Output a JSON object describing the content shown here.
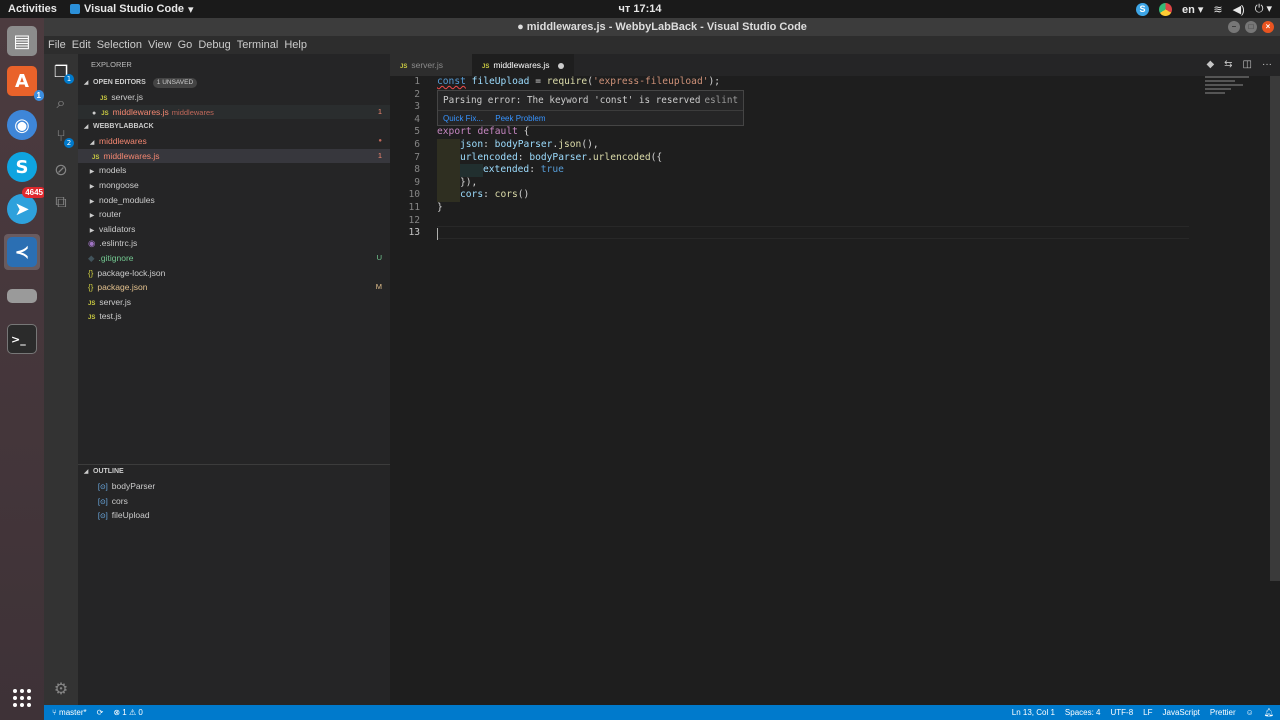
{
  "system": {
    "activities": "Activities",
    "app_name": "Visual Studio Code",
    "clock": "чт 17:14",
    "language": "en",
    "telegram_badge": "4645",
    "files_badge": "1",
    "scm_badge": "2"
  },
  "window": {
    "title": "● middlewares.js - WebbyLabBack - Visual Studio Code"
  },
  "menu": [
    "File",
    "Edit",
    "Selection",
    "View",
    "Go",
    "Debug",
    "Terminal",
    "Help"
  ],
  "explorer": {
    "title": "EXPLORER",
    "open_editors_label": "OPEN EDITORS",
    "unsaved_label": "1 UNSAVED",
    "open_editors": [
      {
        "name": "server.js",
        "folder": "",
        "badge": ""
      },
      {
        "name": "middlewares.js",
        "folder": "middlewares",
        "badge": "1"
      }
    ],
    "project_label": "WEBBYLABBACK",
    "tree": [
      {
        "name": "middlewares",
        "type": "folder-open",
        "badge": "●"
      },
      {
        "name": "middlewares.js",
        "type": "js",
        "badge": "1"
      },
      {
        "name": "models",
        "type": "folder",
        "badge": ""
      },
      {
        "name": "mongoose",
        "type": "folder",
        "badge": ""
      },
      {
        "name": "node_modules",
        "type": "folder",
        "badge": ""
      },
      {
        "name": "router",
        "type": "folder",
        "badge": ""
      },
      {
        "name": "validators",
        "type": "folder",
        "badge": ""
      },
      {
        "name": ".eslintrc.js",
        "type": "eslint",
        "badge": ""
      },
      {
        "name": ".gitignore",
        "type": "git",
        "badge": "U"
      },
      {
        "name": "package-lock.json",
        "type": "json",
        "badge": ""
      },
      {
        "name": "package.json",
        "type": "json",
        "badge": "M"
      },
      {
        "name": "server.js",
        "type": "js",
        "badge": ""
      },
      {
        "name": "test.js",
        "type": "js",
        "badge": ""
      }
    ],
    "outline_label": "OUTLINE",
    "outline": [
      "bodyParser",
      "cors",
      "fileUpload"
    ]
  },
  "tabs": [
    {
      "name": "server.js",
      "active": false
    },
    {
      "name": "middlewares.js",
      "active": true
    }
  ],
  "code": {
    "line_numbers": [
      "1",
      "2",
      "3",
      "4",
      "5",
      "6",
      "7",
      "8",
      "9",
      "10",
      "11",
      "12",
      "13"
    ],
    "lines": {
      "l1_kw": "const",
      "l1_var": "fileUpload",
      "l1_eq": " = ",
      "l1_fn": "require",
      "l1_p1": "(",
      "l1_str": "'express-fileupload'",
      "l1_p2": ");",
      "l5_kw1": "export",
      "l5_kw2": "default",
      "l5_rest": " {",
      "l6_prop": "json",
      "l6_c": ": ",
      "l6_var": "bodyParser",
      "l6_dot": ".",
      "l6_fn": "json",
      "l6_end": "(),",
      "l7_prop": "urlencoded",
      "l7_c": ": ",
      "l7_var": "bodyParser",
      "l7_dot": ".",
      "l7_fn": "urlencoded",
      "l7_end": "({",
      "l8_prop": "extended",
      "l8_c": ": ",
      "l8_kw": "true",
      "l9": "}),",
      "l10_prop": "cors",
      "l10_c": ": ",
      "l10_fn": "cors",
      "l10_end": "()",
      "l11": "}"
    }
  },
  "hover": {
    "message": "Parsing error: The keyword 'const' is reserved",
    "source": "eslint",
    "quick_fix": "Quick Fix...",
    "peek_problem": "Peek Problem"
  },
  "status": {
    "branch": "master*",
    "errors": "1",
    "warnings": "0",
    "position": "Ln 13, Col 1",
    "spaces": "Spaces: 4",
    "encoding": "UTF-8",
    "eol": "LF",
    "language": "JavaScript",
    "formatter": "Prettier"
  },
  "colors": {
    "accent": "#007acc",
    "ubuntu_orange": "#e95420",
    "error": "#f48771"
  }
}
